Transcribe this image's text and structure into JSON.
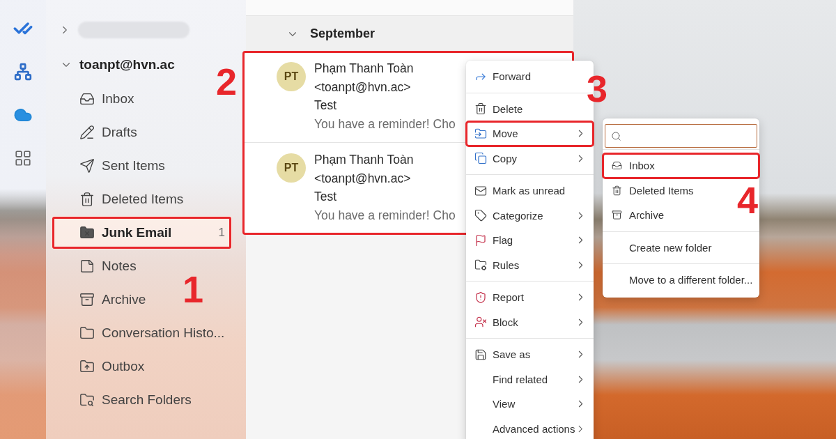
{
  "folder_pane": {
    "collapsed_group": {
      "expanded": false
    },
    "account": {
      "label": "toanpt@hvn.ac",
      "expanded": true
    },
    "folders": [
      {
        "label": "Inbox",
        "kind": "inbox",
        "selected": false,
        "highlighted": false
      },
      {
        "label": "Drafts",
        "kind": "drafts",
        "selected": false,
        "highlighted": false
      },
      {
        "label": "Sent Items",
        "kind": "sent",
        "selected": false,
        "highlighted": false
      },
      {
        "label": "Deleted Items",
        "kind": "deleted",
        "selected": false,
        "highlighted": false
      },
      {
        "label": "Junk Email",
        "kind": "junk",
        "selected": true,
        "highlighted": true,
        "count": "1"
      },
      {
        "label": "Notes",
        "kind": "notes",
        "selected": false,
        "highlighted": false
      },
      {
        "label": "Archive",
        "kind": "archive",
        "selected": false,
        "highlighted": false
      },
      {
        "label": "Conversation Histo...",
        "kind": "folder",
        "selected": false,
        "highlighted": false
      },
      {
        "label": "Outbox",
        "kind": "outbox",
        "selected": false,
        "highlighted": false
      },
      {
        "label": "Search Folders",
        "kind": "search",
        "selected": false,
        "highlighted": false
      }
    ]
  },
  "message_list": {
    "group": {
      "label": "September",
      "expanded": true
    },
    "highlighted": true,
    "messages": [
      {
        "initials": "PT",
        "sender": "Phạm Thanh Toàn",
        "address": "<toanpt@hvn.ac>",
        "subject": "Test",
        "preview": "You have a reminder! Cho"
      },
      {
        "initials": "PT",
        "sender": "Phạm Thanh Toàn",
        "address": "<toanpt@hvn.ac>",
        "subject": "Test",
        "preview": "You have a reminder! Cho"
      }
    ]
  },
  "context_menu": {
    "sections": [
      {
        "items": [
          {
            "label": "Forward",
            "kind": "forward",
            "submenu": false,
            "highlighted": false
          }
        ]
      },
      {
        "items": [
          {
            "label": "Delete",
            "kind": "delete",
            "submenu": false,
            "highlighted": false
          },
          {
            "label": "Move",
            "kind": "move",
            "submenu": true,
            "highlighted": true
          },
          {
            "label": "Copy",
            "kind": "copy",
            "submenu": true,
            "highlighted": false
          }
        ]
      },
      {
        "items": [
          {
            "label": "Mark as unread",
            "kind": "unread",
            "submenu": false,
            "highlighted": false
          },
          {
            "label": "Categorize",
            "kind": "categorize",
            "submenu": true,
            "highlighted": false
          },
          {
            "label": "Flag",
            "kind": "flag",
            "submenu": true,
            "highlighted": false
          },
          {
            "label": "Rules",
            "kind": "rules",
            "submenu": true,
            "highlighted": false
          }
        ]
      },
      {
        "items": [
          {
            "label": "Report",
            "kind": "report",
            "submenu": true,
            "highlighted": false
          },
          {
            "label": "Block",
            "kind": "block",
            "submenu": true,
            "highlighted": false
          }
        ]
      },
      {
        "items": [
          {
            "label": "Save as",
            "kind": "save",
            "submenu": true,
            "highlighted": false
          },
          {
            "label": "Find related",
            "kind": "none",
            "submenu": true,
            "highlighted": false
          },
          {
            "label": "View",
            "kind": "none",
            "submenu": true,
            "highlighted": false
          },
          {
            "label": "Advanced actions",
            "kind": "none",
            "submenu": true,
            "highlighted": false
          }
        ]
      }
    ]
  },
  "move_submenu": {
    "sections": [
      {
        "items": [
          {
            "label": "Inbox",
            "kind": "inbox",
            "highlighted": true
          },
          {
            "label": "Deleted Items",
            "kind": "deleted",
            "highlighted": false
          },
          {
            "label": "Archive",
            "kind": "archive",
            "highlighted": false
          }
        ]
      },
      {
        "items": [
          {
            "label": "Create new folder",
            "kind": "none",
            "highlighted": false
          }
        ]
      },
      {
        "items": [
          {
            "label": "Move to a different folder...",
            "kind": "none",
            "highlighted": false
          }
        ]
      }
    ]
  },
  "annotations": [
    {
      "label": "1"
    },
    {
      "label": "2"
    },
    {
      "label": "3"
    },
    {
      "label": "4"
    }
  ]
}
